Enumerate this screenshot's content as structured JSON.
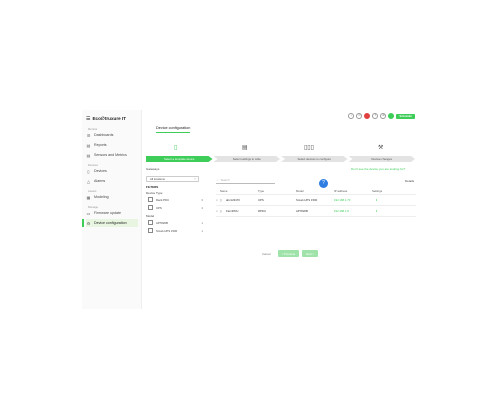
{
  "app": {
    "logo": "Eco∅truxure IT",
    "menu_icon": "hamburger-icon"
  },
  "sidebar": {
    "sections": [
      {
        "label": "Monitor"
      },
      {
        "label": "Devices"
      },
      {
        "label": "Assets"
      },
      {
        "label": "Manage"
      }
    ],
    "items": [
      {
        "label": "Dashboards",
        "icon": "dashboard-icon",
        "glyph": "☰"
      },
      {
        "label": "Reports",
        "icon": "report-icon",
        "glyph": "▤"
      },
      {
        "label": "Sensors and Metrics",
        "icon": "sensor-icon",
        "glyph": "▤"
      },
      {
        "label": "Devices",
        "icon": "device-icon",
        "glyph": "▯"
      },
      {
        "label": "Alarms",
        "icon": "alarm-icon",
        "glyph": "△"
      },
      {
        "label": "Modeling",
        "icon": "modeling-icon",
        "glyph": "▦"
      },
      {
        "label": "Firmware update",
        "icon": "firmware-icon",
        "glyph": "▭"
      },
      {
        "label": "Device configuration",
        "icon": "config-icon",
        "glyph": "⚙"
      }
    ]
  },
  "header": {
    "tab": "Device configuration",
    "brand": "Schneider"
  },
  "steps": [
    {
      "label": "Select a template device",
      "icon": "device-icon",
      "glyph": "▯"
    },
    {
      "label": "Select settings to write",
      "icon": "settings-doc-icon",
      "glyph": "▤"
    },
    {
      "label": "Select devices to configure",
      "icon": "devices-icon",
      "glyph": "▯▯▯"
    },
    {
      "label": "Review changes",
      "icon": "review-icon",
      "glyph": "⚒"
    }
  ],
  "panel": {
    "gateways_label": "Gateways",
    "location_value": "All locations",
    "filters_label": "FILTERS",
    "device_type_label": "Device Type",
    "device_types": [
      {
        "label": "Rack PDU",
        "count": "0"
      },
      {
        "label": "UPS",
        "count": "2"
      }
    ],
    "model_label": "Model",
    "models": [
      {
        "label": "AP7820B",
        "count": "1"
      },
      {
        "label": "Smart-UPS 1500",
        "count": "1"
      }
    ],
    "search_placeholder": "Search",
    "help_link": "Don't see the device you are looking for?",
    "details_link": "Details"
  },
  "table": {
    "headers": [
      "Name",
      "Type",
      "Model",
      "IP address",
      "Settings"
    ],
    "rows": [
      {
        "name": "abc123470",
        "type": "UPS",
        "model": "Smart-UPS 1500",
        "ip": "192.168.1.70",
        "settings": "ℹ"
      },
      {
        "name": "FarmPDU",
        "type": "RPDU",
        "model": "AP7820B",
        "ip": "192.168.1.8",
        "settings": "ℹ"
      }
    ]
  },
  "buttons": {
    "cancel": "Cancel",
    "previous": "< Previous",
    "next": "Next >"
  },
  "fab": {
    "glyph": "?",
    "icon": "help-icon"
  }
}
